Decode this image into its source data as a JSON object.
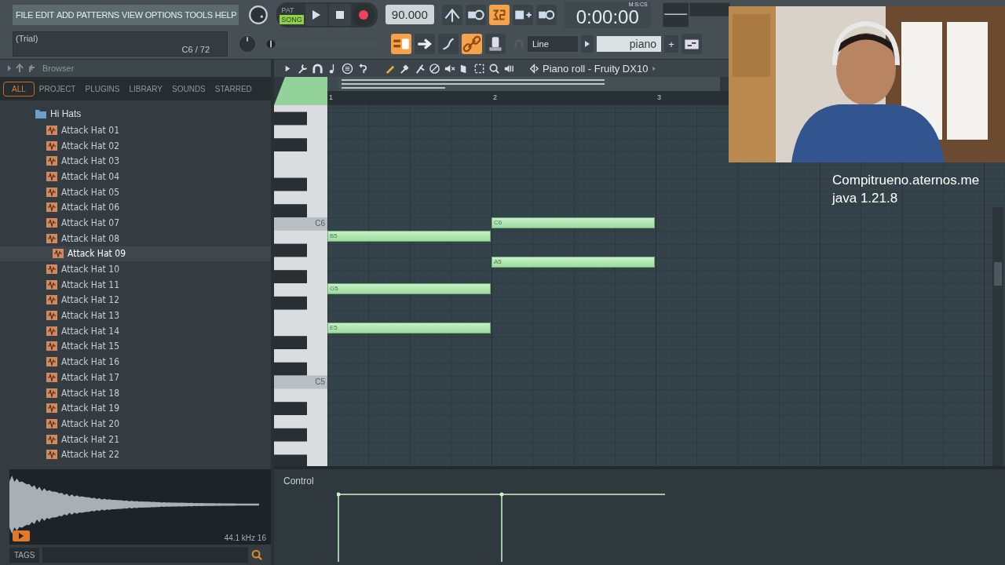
{
  "menu": [
    "FILE",
    "EDIT",
    "ADD",
    "PATTERNS",
    "VIEW",
    "OPTIONS",
    "TOOLS",
    "HELP"
  ],
  "hint": {
    "text": "(Trial)",
    "note": "C6 / 72"
  },
  "transport": {
    "modes": [
      {
        "label": "PAT",
        "selected": false
      },
      {
        "label": "SONG",
        "selected": true
      }
    ],
    "tempo": "90.000",
    "time": "0:00:00",
    "time_format": "M:S:CS"
  },
  "tools": {
    "snap": "Line",
    "preset": "piano",
    "add": "+"
  },
  "browser": {
    "title": "Browser",
    "tabs": [
      {
        "label": "ALL",
        "selected": true
      },
      {
        "label": "PROJECT",
        "selected": false
      },
      {
        "label": "PLUGINS",
        "selected": false
      },
      {
        "label": "LIBRARY",
        "selected": false
      },
      {
        "label": "SOUNDS",
        "selected": false
      },
      {
        "label": "STARRED",
        "selected": false
      }
    ],
    "tree": [
      {
        "label": "Hi Hats",
        "expanded": true,
        "children": [
          {
            "label": "Attack Hat 01",
            "selected": false
          },
          {
            "label": "Attack Hat 02",
            "selected": false
          },
          {
            "label": "Attack Hat 03",
            "selected": false
          },
          {
            "label": "Attack Hat 04",
            "selected": false
          },
          {
            "label": "Attack Hat 05",
            "selected": false
          },
          {
            "label": "Attack Hat 06",
            "selected": false
          },
          {
            "label": "Attack Hat 07",
            "selected": false
          },
          {
            "label": "Attack Hat 08",
            "selected": false
          },
          {
            "label": "Attack Hat 09",
            "selected": true
          },
          {
            "label": "Attack Hat 10",
            "selected": false
          },
          {
            "label": "Attack Hat 11",
            "selected": false
          },
          {
            "label": "Attack Hat 12",
            "selected": false
          },
          {
            "label": "Attack Hat 13",
            "selected": false
          },
          {
            "label": "Attack Hat 14",
            "selected": false
          },
          {
            "label": "Attack Hat 15",
            "selected": false
          },
          {
            "label": "Attack Hat 16",
            "selected": false
          },
          {
            "label": "Attack Hat 17",
            "selected": false
          },
          {
            "label": "Attack Hat 18",
            "selected": false
          },
          {
            "label": "Attack Hat 19",
            "selected": false
          },
          {
            "label": "Attack Hat 20",
            "selected": false
          },
          {
            "label": "Attack Hat 21",
            "selected": false
          },
          {
            "label": "Attack Hat 22",
            "selected": false
          }
        ]
      }
    ],
    "sample_info": "44.1 kHz 16",
    "tags": "TAGS"
  },
  "piano_roll": {
    "title": "Piano roll - Fruity DX10",
    "bars": [
      "1",
      "2",
      "3"
    ],
    "key_labels": [
      "C6",
      "C5"
    ],
    "notes": [
      {
        "label": "C6"
      },
      {
        "label": "B5"
      },
      {
        "label": "A5"
      },
      {
        "label": "G5"
      },
      {
        "label": "E5"
      }
    ],
    "control": "Control"
  },
  "overlay": [
    "Compitrueno.aternos.me",
    "java 1.21.8"
  ]
}
